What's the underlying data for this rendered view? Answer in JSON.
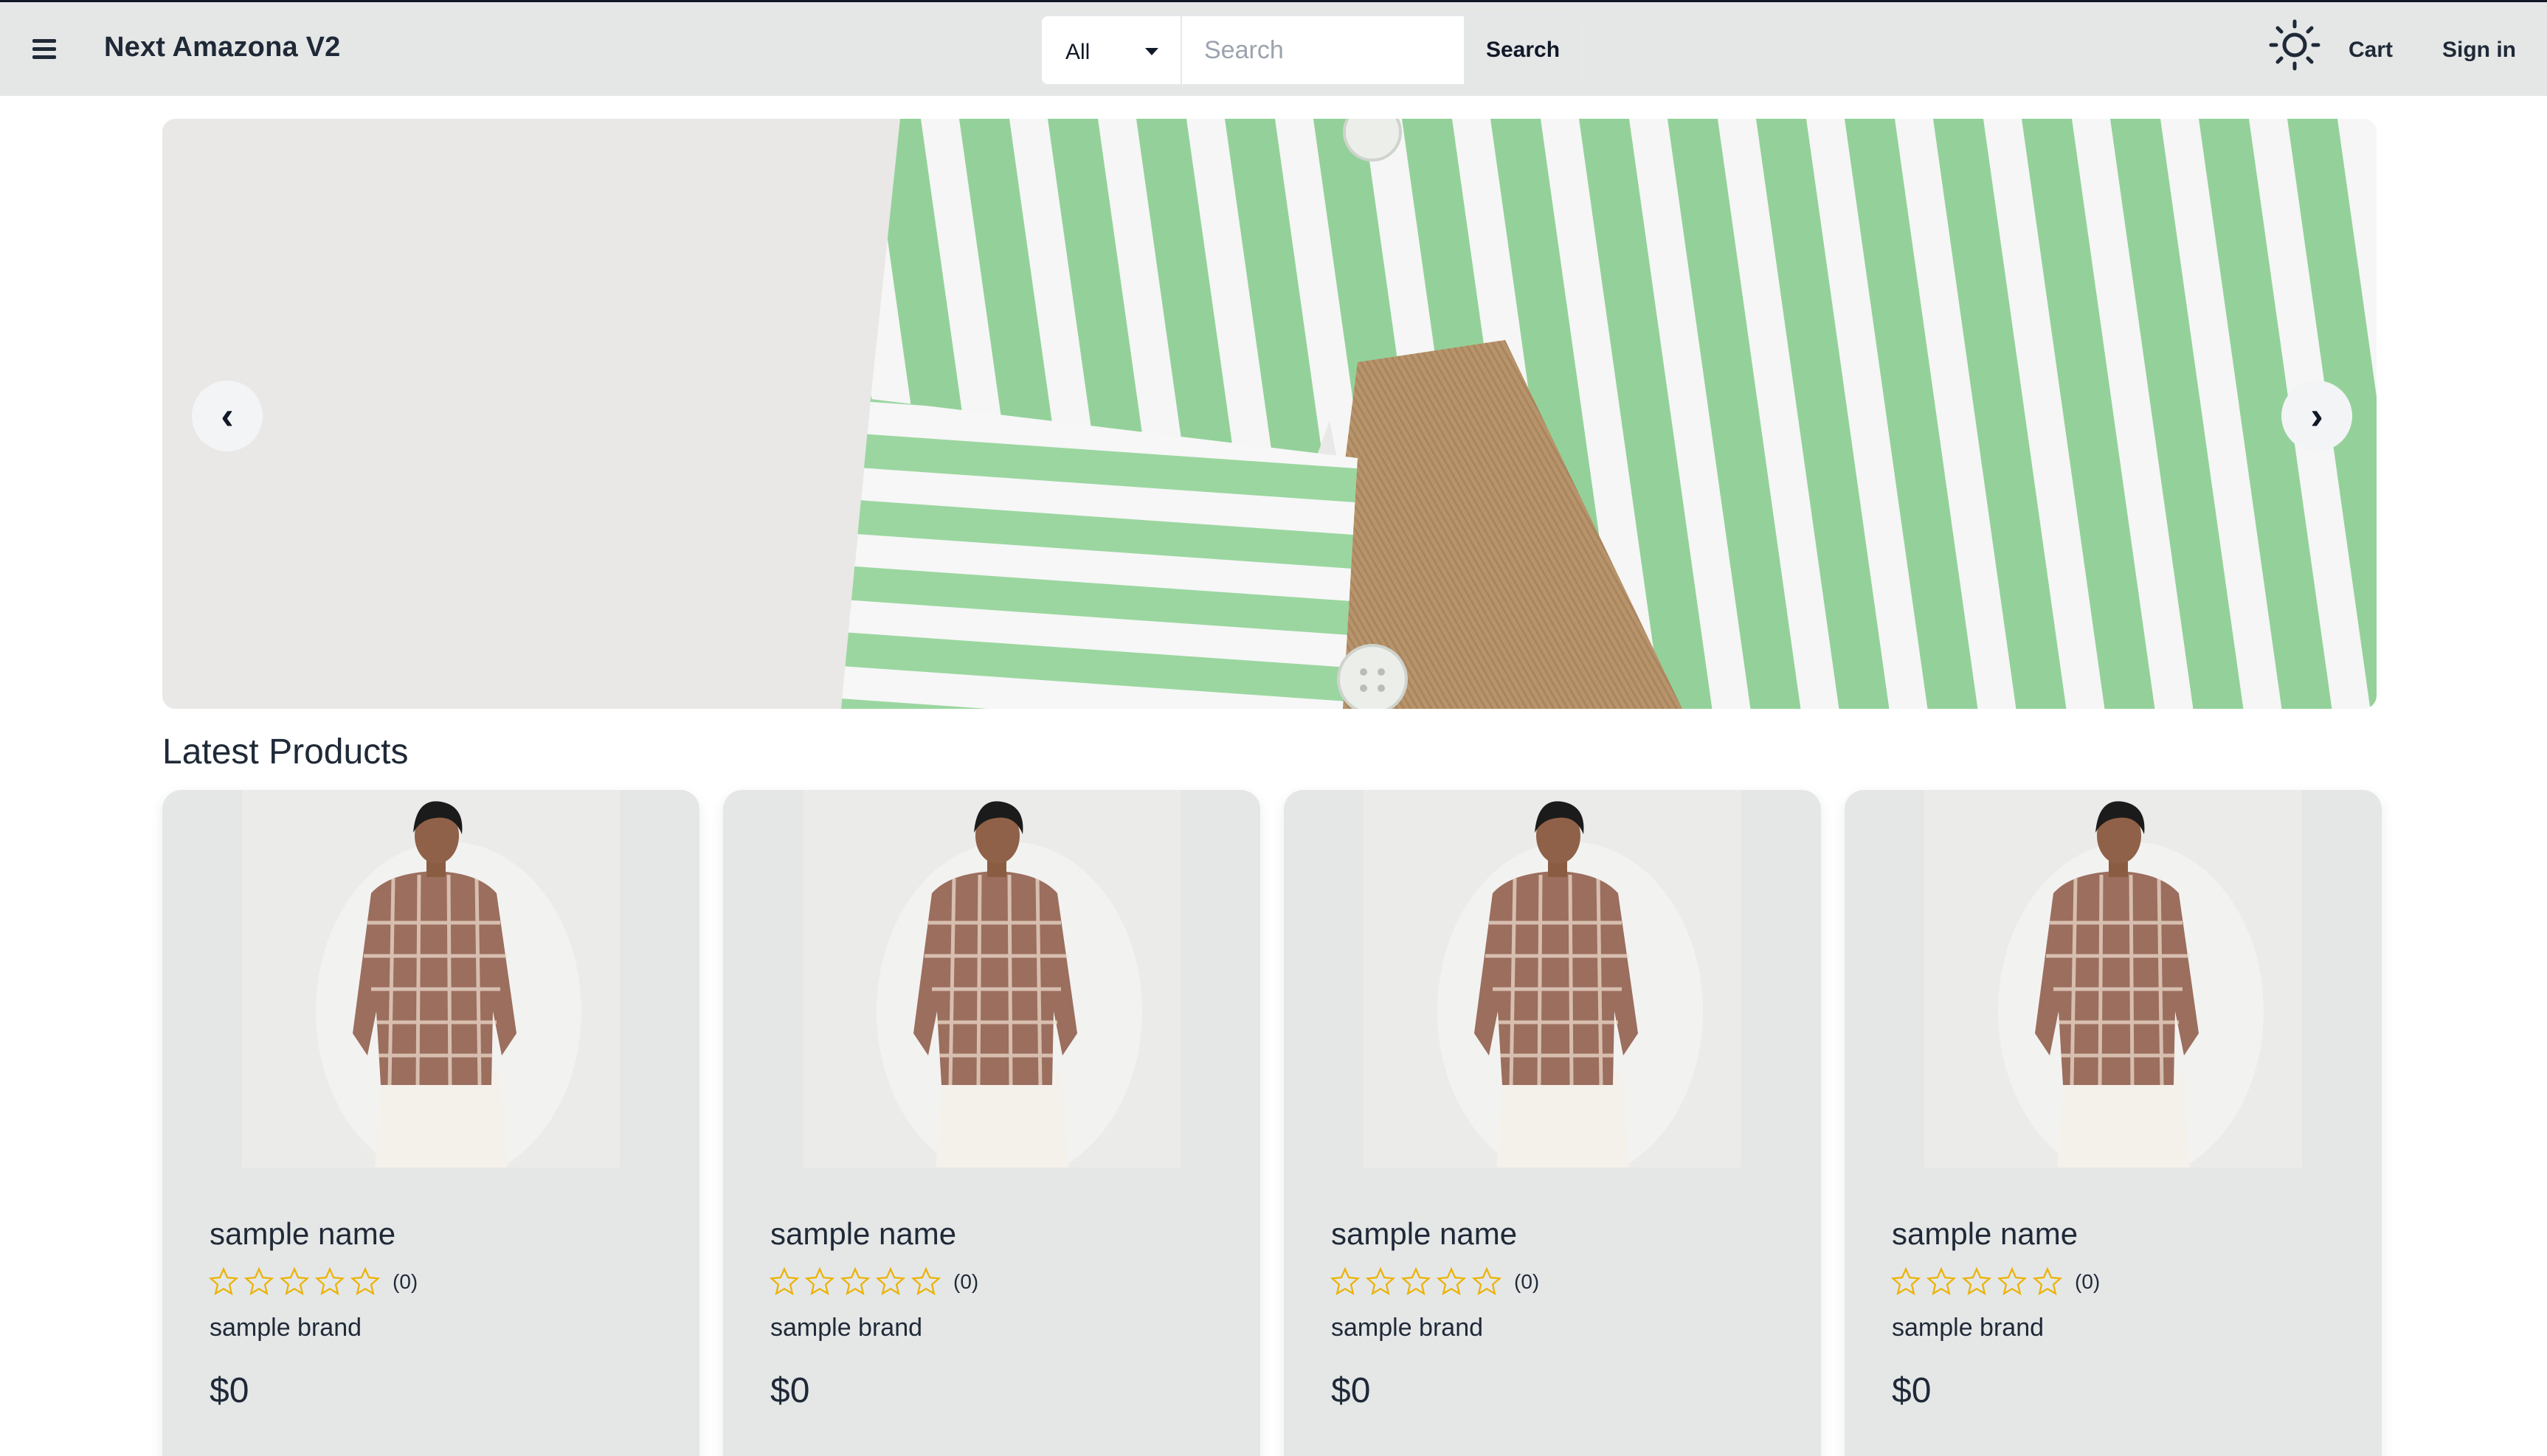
{
  "navbar": {
    "brand": "Next Amazona V2",
    "category_selected": "All",
    "search_placeholder": "Search",
    "search_button": "Search",
    "theme_icon": "sun-icon",
    "cart": "Cart",
    "sign_in": "Sign in"
  },
  "carousel": {
    "prev_label": "‹",
    "next_label": "›"
  },
  "latest": {
    "title": "Latest Products",
    "products": [
      {
        "name": "sample name",
        "rating": 0,
        "reviews": "(0)",
        "brand": "sample brand",
        "price": "$0"
      },
      {
        "name": "sample name",
        "rating": 0,
        "reviews": "(0)",
        "brand": "sample brand",
        "price": "$0"
      },
      {
        "name": "sample name",
        "rating": 0,
        "reviews": "(0)",
        "brand": "sample brand",
        "price": "$0"
      },
      {
        "name": "sample name",
        "rating": 0,
        "reviews": "(0)",
        "brand": "sample brand",
        "price": "$0"
      }
    ]
  },
  "colors": {
    "navbar_bg": "#e5e7e7",
    "card_bg": "#e5e7e7",
    "star": "#eab308",
    "text": "#1f2937",
    "stripe_green": "#94d19a"
  }
}
